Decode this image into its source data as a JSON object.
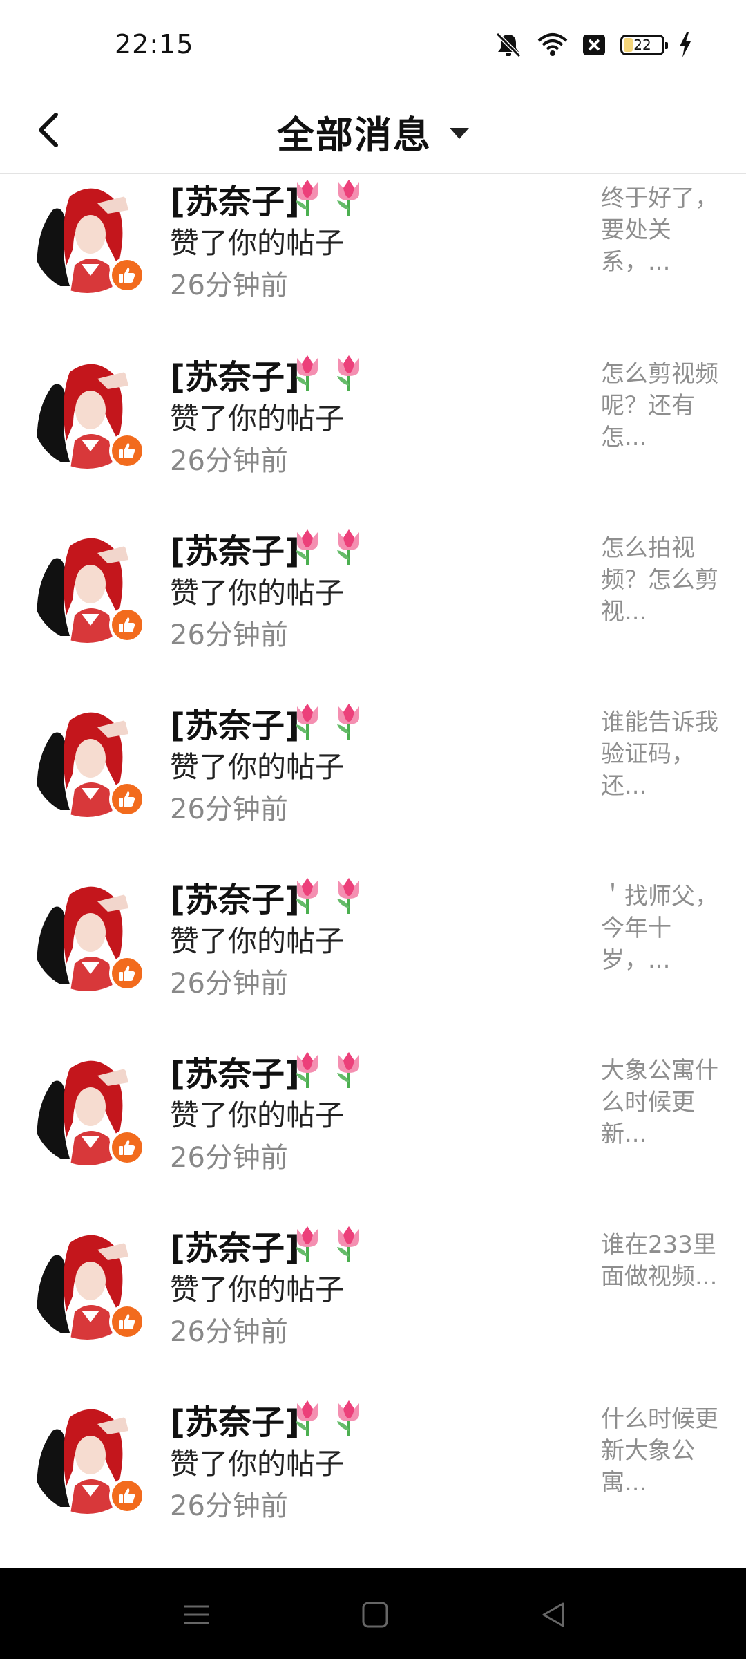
{
  "status_bar": {
    "time": "22:15",
    "battery": "22"
  },
  "header": {
    "title": "全部消息"
  },
  "colors": {
    "badge": "#f26b1d",
    "preview_text": "#8e8e8e",
    "time_text": "#888888"
  },
  "notifications": [
    {
      "user": "[苏奈子]",
      "action": "赞了你的帖子",
      "time": "26分钟前",
      "preview": "终于好了，要处关系，..."
    },
    {
      "user": "[苏奈子]",
      "action": "赞了你的帖子",
      "time": "26分钟前",
      "preview": "怎么剪视频呢？还有怎..."
    },
    {
      "user": "[苏奈子]",
      "action": "赞了你的帖子",
      "time": "26分钟前",
      "preview": "怎么拍视频？怎么剪视..."
    },
    {
      "user": "[苏奈子]",
      "action": "赞了你的帖子",
      "time": "26分钟前",
      "preview": "谁能告诉我验证码，还..."
    },
    {
      "user": "[苏奈子]",
      "action": "赞了你的帖子",
      "time": "26分钟前",
      "preview": "＇找师父，今年十岁，..."
    },
    {
      "user": "[苏奈子]",
      "action": "赞了你的帖子",
      "time": "26分钟前",
      "preview": "大象公寓什么时候更新..."
    },
    {
      "user": "[苏奈子]",
      "action": "赞了你的帖子",
      "time": "26分钟前",
      "preview": "谁在233里面做视频..."
    },
    {
      "user": "[苏奈子]",
      "action": "赞了你的帖子",
      "time": "26分钟前",
      "preview": "什么时候更新大象公寓..."
    }
  ]
}
